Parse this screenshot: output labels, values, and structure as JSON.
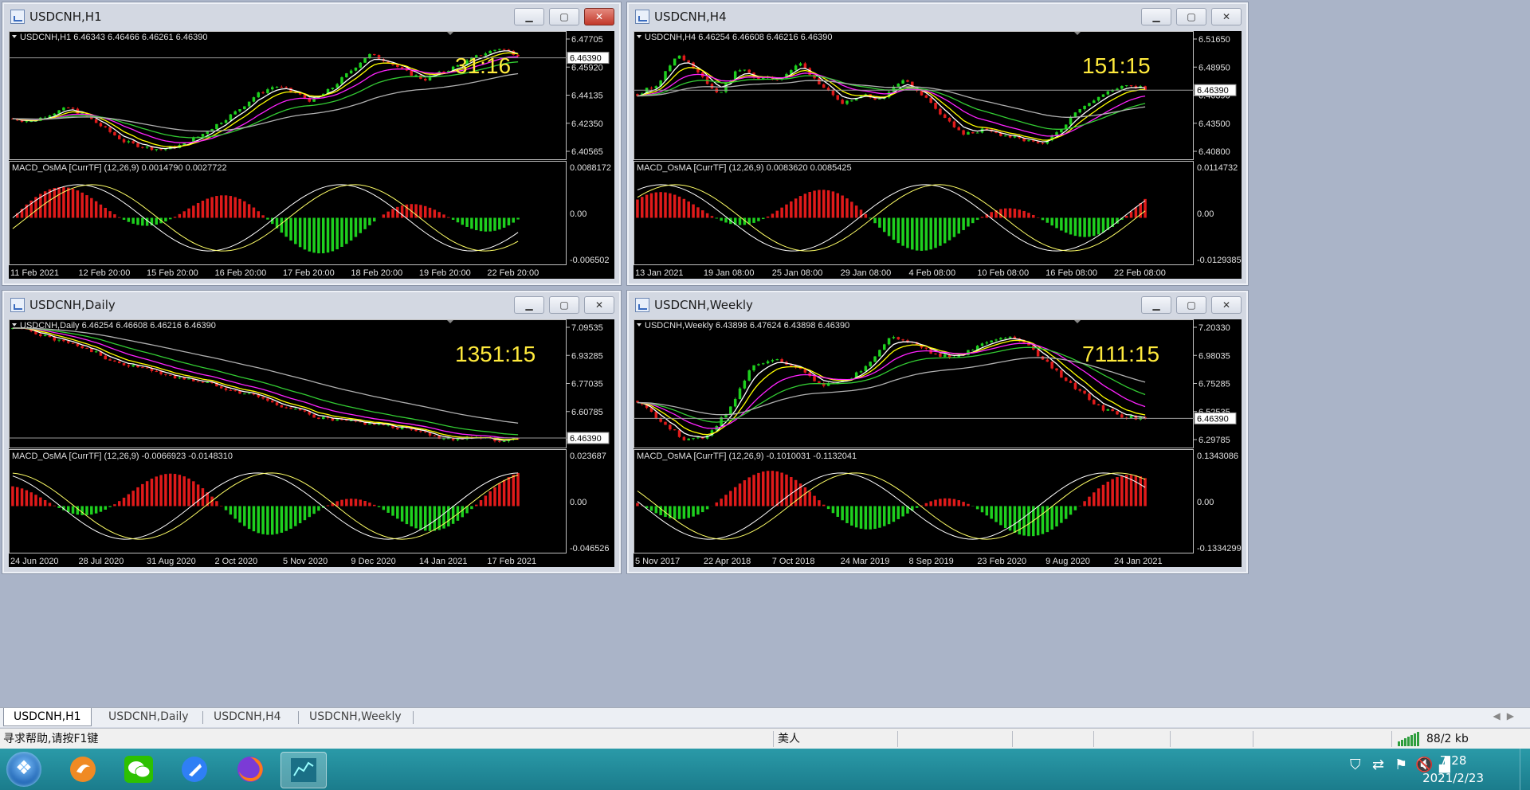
{
  "colors": {
    "background": "#000000",
    "axis": "#c0c0c0",
    "text": "#e0e0e0",
    "timer": "#ffea3c",
    "up": "#1ed01e",
    "down": "#e01a1a",
    "ema_fast": "#ffffff",
    "ema_mid": "#ffff00",
    "ema_slow": "#ff22ff",
    "ema_50": "#33cc33",
    "ema_100": "#b0b0b0"
  },
  "windows": [
    {
      "title": "USDCNH,H1",
      "info": "USDCNH,H1  6.46343 6.46466 6.46261 6.46390",
      "price_labels": [
        "6.47705",
        "6.45920",
        "6.44135",
        "6.42350",
        "6.40565"
      ],
      "price_ylim": [
        6.4,
        6.48
      ],
      "current_price": "6.46390",
      "countdown": "31:16",
      "macd_label": "MACD_OsMA [CurrTF] (12,26,9) 0.0014790 0.0027722",
      "macd_labels": [
        "0.0088172",
        "0.00",
        "-0.006502"
      ],
      "time_labels": [
        "11 Feb 2021",
        "12 Feb 20:00",
        "15 Feb 20:00",
        "16 Feb 20:00",
        "17 Feb 20:00",
        "18 Feb 20:00",
        "19 Feb 20:00",
        "22 Feb 20:00"
      ],
      "chart_data": {
        "type": "line",
        "series": [
          {
            "values": [
              6.425,
              6.423,
              6.428,
              6.432,
              6.426,
              6.418,
              6.41,
              6.407,
              6.405,
              6.408,
              6.414,
              6.422,
              6.43,
              6.44,
              6.446,
              6.442,
              6.436,
              6.444,
              6.455,
              6.466,
              6.462,
              6.455,
              6.45,
              6.455,
              6.46,
              6.466,
              6.47,
              6.466
            ]
          }
        ]
      },
      "max_close": [
        "btn-min",
        "btn-max",
        "btn-close-red"
      ]
    },
    {
      "title": "USDCNH,H4",
      "info": "USDCNH,H4  6.46254 6.46608 6.46216 6.46390",
      "price_labels": [
        "6.51650",
        "6.48950",
        "6.46390",
        "6.43500",
        "6.40800"
      ],
      "price_ylim": [
        6.398,
        6.52
      ],
      "current_price": "6.46390",
      "countdown": "151:15",
      "macd_label": "MACD_OsMA [CurrTF] (12,26,9) 0.0083620 0.0085425",
      "macd_labels": [
        "0.0114732",
        "0.00",
        "-0.0129385"
      ],
      "time_labels": [
        "13 Jan 2021",
        "19 Jan 08:00",
        "25 Jan 08:00",
        "29 Jan 08:00",
        "4 Feb 08:00",
        "10 Feb 08:00",
        "16 Feb 08:00",
        "22 Feb 08:00"
      ],
      "chart_data": {
        "type": "line",
        "series": [
          {
            "values": [
              6.46,
              6.47,
              6.5,
              6.48,
              6.46,
              6.485,
              6.475,
              6.475,
              6.49,
              6.47,
              6.45,
              6.46,
              6.455,
              6.475,
              6.46,
              6.44,
              6.42,
              6.425,
              6.42,
              6.415,
              6.41,
              6.43,
              6.45,
              6.46,
              6.47,
              6.465
            ]
          }
        ]
      }
    },
    {
      "title": "USDCNH,Daily",
      "info": "USDCNH,Daily  6.46254 6.46608 6.46216 6.46390",
      "price_labels": [
        "7.09535",
        "6.93285",
        "6.77035",
        "6.60785",
        "6.44535"
      ],
      "price_ylim": [
        6.42,
        7.11
      ],
      "current_price": "6.46390",
      "countdown": "1351:15",
      "macd_label": "MACD_OsMA [CurrTF] (12,26,9) -0.0066923 -0.0148310",
      "macd_labels": [
        "0.023687",
        "0.00",
        "-0.046526"
      ],
      "time_labels": [
        "24 Jun 2020",
        "28 Jul 2020",
        "31 Aug 2020",
        "2 Oct 2020",
        "5 Nov 2020",
        "9 Dec 2020",
        "14 Jan 2021",
        "17 Feb 2021"
      ],
      "chart_data": {
        "type": "line",
        "series": [
          {
            "values": [
              7.07,
              7.05,
              7.01,
              6.98,
              6.94,
              6.88,
              6.86,
              6.83,
              6.8,
              6.78,
              6.76,
              6.72,
              6.7,
              6.65,
              6.62,
              6.58,
              6.56,
              6.55,
              6.54,
              6.52,
              6.51,
              6.47,
              6.46,
              6.47,
              6.45,
              6.46
            ]
          }
        ]
      }
    },
    {
      "title": "USDCNH,Weekly",
      "info": "USDCNH,Weekly  6.43898 6.47624 6.43898 6.46390",
      "price_labels": [
        "7.20330",
        "6.98035",
        "6.75285",
        "6.52535",
        "6.29785"
      ],
      "price_ylim": [
        6.25,
        7.22
      ],
      "current_price": "6.46390",
      "countdown": "7111:15",
      "macd_label": "MACD_OsMA [CurrTF] (12,26,9) -0.1010031 -0.1132041",
      "macd_labels": [
        "0.1343086",
        "0.00",
        "-0.1334299"
      ],
      "time_labels": [
        "5 Nov 2017",
        "22 Apr 2018",
        "7 Oct 2018",
        "24 Mar 2019",
        "8 Sep 2019",
        "23 Feb 2020",
        "9 Aug 2020",
        "24 Jan 2021"
      ],
      "chart_data": {
        "type": "line",
        "series": [
          {
            "values": [
              6.6,
              6.45,
              6.3,
              6.32,
              6.55,
              6.88,
              6.92,
              6.85,
              6.72,
              6.75,
              6.88,
              7.1,
              7.05,
              6.95,
              6.95,
              7.05,
              7.1,
              7.02,
              6.85,
              6.7,
              6.55,
              6.48,
              6.46
            ]
          }
        ]
      }
    }
  ],
  "tabs": [
    "USDCNH,H1",
    "USDCNH,Daily",
    "USDCNH,H4",
    "USDCNH,Weekly"
  ],
  "status": {
    "help": "寻求帮助,请按F1键",
    "profile": "美人",
    "traffic": "88/2 kb"
  },
  "clock": {
    "time": "7:28",
    "date": "2021/2/23"
  },
  "taskbar_icons": [
    "windows-start-icon",
    "app-orange-icon",
    "wechat-icon",
    "feishu-icon",
    "firefox-icon",
    "mt4-terminal-icon"
  ]
}
